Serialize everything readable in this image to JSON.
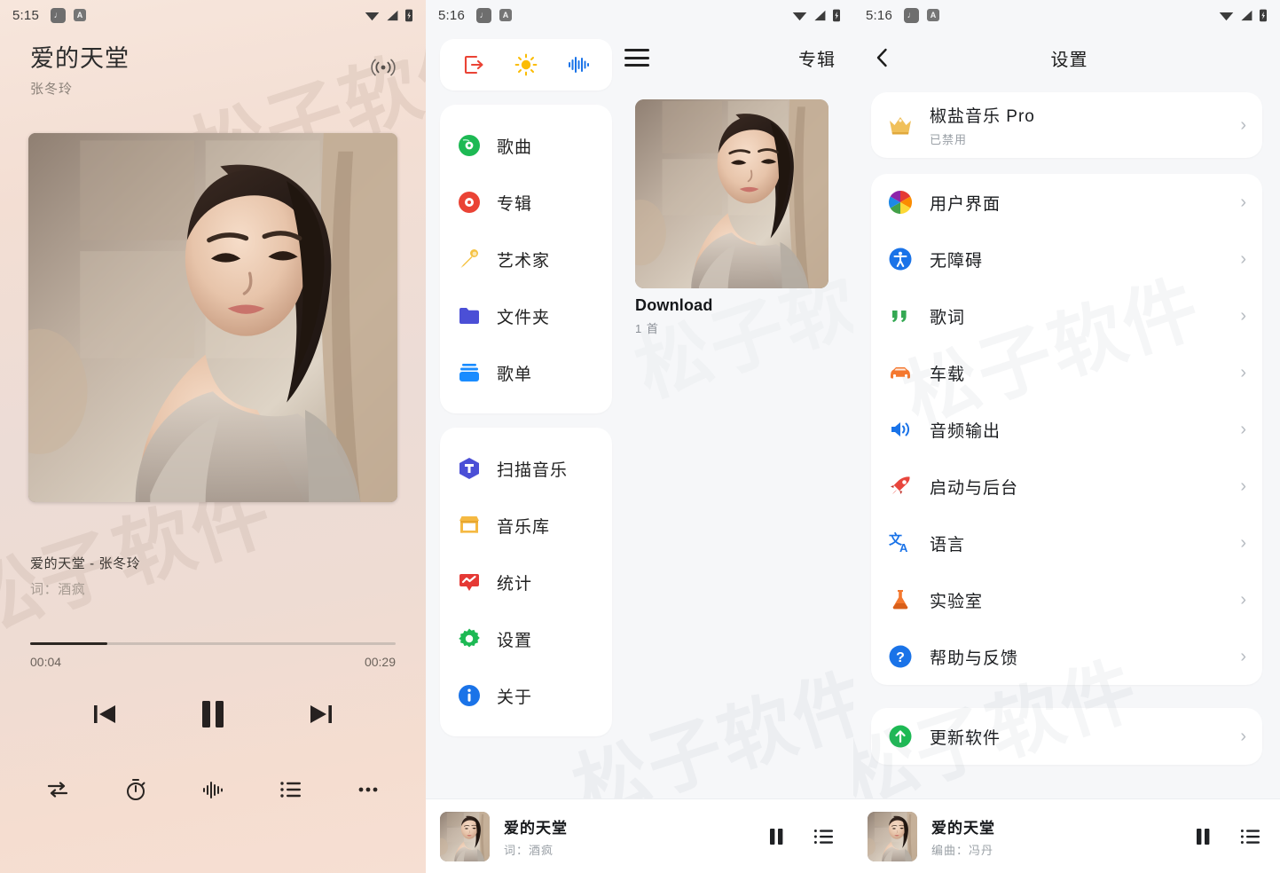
{
  "panel1": {
    "status": {
      "time": "5:15",
      "badge1": "♩",
      "badge2": "A"
    },
    "now_playing": {
      "title": "爱的天堂",
      "artist": "张冬玲"
    },
    "cast_icon": "cast-icon",
    "lyric": {
      "line1": "爱的天堂 - 张冬玲",
      "line2": "词：酒疯"
    },
    "seek": {
      "elapsed": "00:04",
      "total": "00:29",
      "progress_percent": 21
    },
    "transport": {
      "prev": "previous-track",
      "pause": "pause",
      "next": "next-track"
    },
    "bottom_icons": [
      "repeat-icon",
      "timer-icon",
      "equalizer-icon",
      "playlist-icon",
      "more-icon"
    ],
    "watermark": "松子软件"
  },
  "panel2": {
    "status": {
      "time": "5:16",
      "badge1": "♩",
      "badge2": "A"
    },
    "toolbar": [
      {
        "name": "exit-icon",
        "color": "#ea4335"
      },
      {
        "name": "brightness-icon",
        "color": "#fbbc04"
      },
      {
        "name": "equalizer-icon",
        "color": "#1a73e8"
      }
    ],
    "menu_primary": [
      {
        "label": "歌曲",
        "icon": "disc-green-icon",
        "color": "#1db954"
      },
      {
        "label": "专辑",
        "icon": "disc-red-icon",
        "color": "#ea4335"
      },
      {
        "label": "艺术家",
        "icon": "microphone-icon",
        "color": "#f5c242"
      },
      {
        "label": "文件夹",
        "icon": "folder-icon",
        "color": "#4b4fd6"
      },
      {
        "label": "歌单",
        "icon": "playlist-stack-icon",
        "color": "#1a8cff"
      }
    ],
    "menu_secondary": [
      {
        "label": "扫描音乐",
        "icon": "scan-icon",
        "color": "#4b4fd6"
      },
      {
        "label": "音乐库",
        "icon": "library-store-icon",
        "color": "#f5b942"
      },
      {
        "label": "统计",
        "icon": "statistics-icon",
        "color": "#e53935"
      },
      {
        "label": "设置",
        "icon": "gear-icon",
        "color": "#1db954"
      },
      {
        "label": "关于",
        "icon": "info-icon",
        "color": "#1a73e8"
      }
    ],
    "header": {
      "menu_icon": "hamburger-icon",
      "title": "专辑"
    },
    "album": {
      "name": "Download",
      "count": "1 首"
    },
    "miniplayer": {
      "title": "爱的天堂",
      "subtitle": "词：酒疯",
      "pause": "pause-icon",
      "queue": "queue-icon"
    },
    "watermark": "松子软件"
  },
  "panel3": {
    "status": {
      "time": "5:16",
      "badge1": "♩",
      "badge2": "A"
    },
    "header": {
      "back": "back-chevron-icon",
      "title": "设置"
    },
    "pro": {
      "label": "椒盐音乐 Pro",
      "sub": "已禁用",
      "icon": "crown-icon",
      "color": "#f0b429"
    },
    "settings_items": [
      {
        "label": "用户界面",
        "icon": "color-wheel-icon",
        "color": "#e91e63"
      },
      {
        "label": "无障碍",
        "icon": "accessibility-icon",
        "color": "#1a73e8"
      },
      {
        "label": "歌词",
        "icon": "quote-icon",
        "color": "#34a853"
      },
      {
        "label": "车载",
        "icon": "car-icon",
        "color": "#f4782f"
      },
      {
        "label": "音频输出",
        "icon": "speaker-icon",
        "color": "#1a73e8"
      },
      {
        "label": "启动与后台",
        "icon": "rocket-icon",
        "color": "#e8453c"
      },
      {
        "label": "语言",
        "icon": "translate-icon",
        "color": "#1a73e8"
      },
      {
        "label": "实验室",
        "icon": "flask-icon",
        "color": "#f4782f"
      },
      {
        "label": "帮助与反馈",
        "icon": "help-icon",
        "color": "#1a73e8"
      }
    ],
    "update": {
      "label": "更新软件",
      "icon": "update-arrow-icon",
      "color": "#1db954"
    },
    "miniplayer": {
      "title": "爱的天堂",
      "subtitle": "编曲：冯丹",
      "pause": "pause-icon",
      "queue": "queue-icon"
    },
    "chevron": "›",
    "watermark": "松子软件"
  }
}
